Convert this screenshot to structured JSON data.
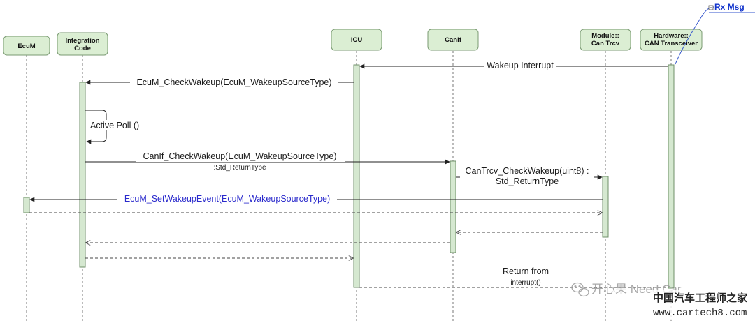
{
  "colors": {
    "box_fill": "#dbeed3",
    "box_stroke": "#7a9a72",
    "activation_fill": "#d5e8d0",
    "line": "#333333",
    "blue_message": "#2a2acc",
    "rx_msg": "#1133cc"
  },
  "participants": [
    {
      "id": "ecum",
      "lines": [
        "EcuM"
      ]
    },
    {
      "id": "integration",
      "lines": [
        "Integration",
        "Code"
      ]
    },
    {
      "id": "icu",
      "lines": [
        "ICU"
      ]
    },
    {
      "id": "canif",
      "lines": [
        "CanIf"
      ]
    },
    {
      "id": "trcv",
      "lines": [
        "Module::",
        "Can Trcv"
      ]
    },
    {
      "id": "hw",
      "lines": [
        "Hardware::",
        "CAN Transceiver"
      ]
    }
  ],
  "rx_msg": {
    "label": "Rx Msg",
    "icon": "collapse-box-icon"
  },
  "messages": [
    {
      "label": "Wakeup Interrupt"
    },
    {
      "label": "EcuM_CheckWakeup(EcuM_WakeupSourceType)"
    },
    {
      "label": "Active Poll  ()"
    },
    {
      "label": "CanIf_CheckWakeup(EcuM_WakeupSourceType)",
      "sublabel": ":Std_ReturnType"
    },
    {
      "label": "CanTrcv_CheckWakeup(uint8) :",
      "sublabel": "Std_ReturnType"
    },
    {
      "label": "EcuM_SetWakeupEvent(EcuM_WakeupSourceType)"
    },
    {
      "label": "Return from",
      "sublabel": "interrupt()"
    }
  ],
  "watermark": {
    "icon": "wechat-icon",
    "text": "开心果 Need Car",
    "site_cn": "中国汽车工程师之家",
    "site_url": "www.cartech8.com"
  }
}
